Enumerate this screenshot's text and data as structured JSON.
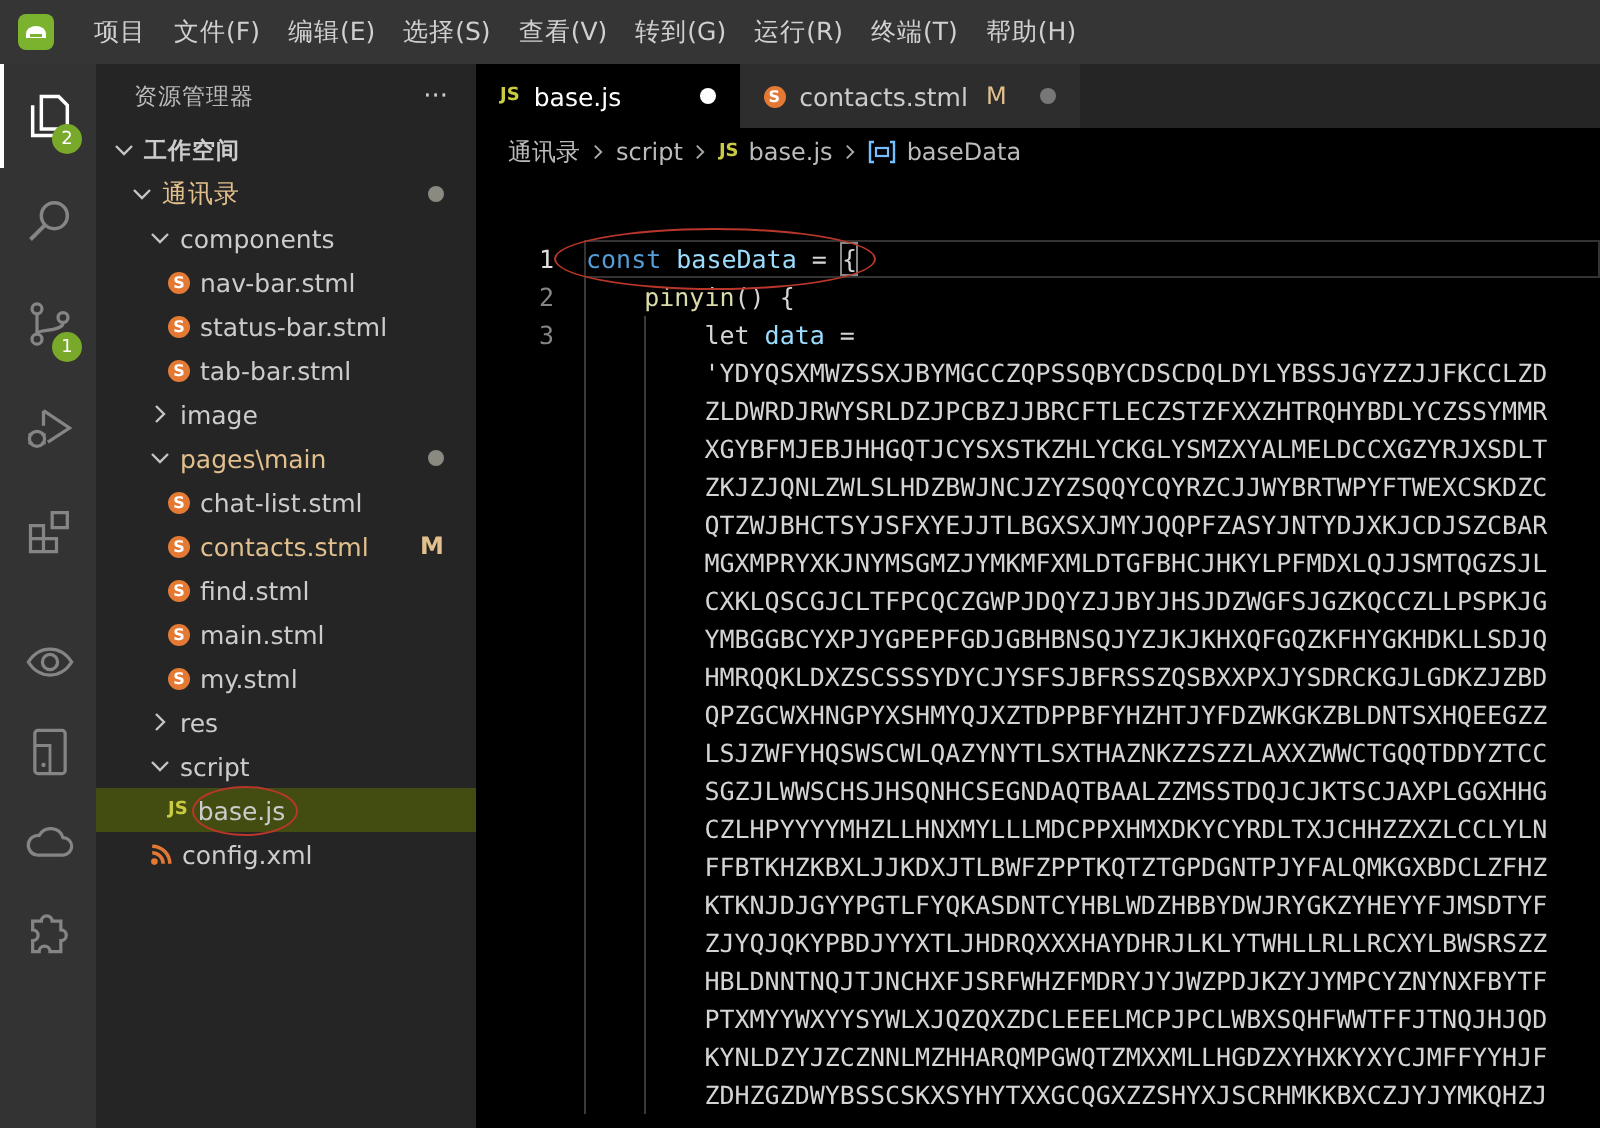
{
  "menu_bar": {
    "items": [
      "项目",
      "文件(F)",
      "编辑(E)",
      "选择(S)",
      "查看(V)",
      "转到(G)",
      "运行(R)",
      "终端(T)",
      "帮助(H)"
    ]
  },
  "activity_bar": [
    {
      "kind": "files",
      "selected": true,
      "badge": "2"
    },
    {
      "kind": "search",
      "selected": false
    },
    {
      "kind": "source-control",
      "selected": false,
      "badge": "1"
    },
    {
      "kind": "run-debug",
      "selected": false
    },
    {
      "kind": "extensions",
      "selected": false
    },
    {
      "kind": "preview",
      "selected": false
    },
    {
      "kind": "device",
      "selected": false
    },
    {
      "kind": "cloud",
      "selected": false
    },
    {
      "kind": "plugin",
      "selected": false
    }
  ],
  "sidebar": {
    "title": "资源管理器",
    "more": "···",
    "tree": [
      {
        "label": "工作空间",
        "kind": "root",
        "expanded": true,
        "selected": false,
        "modified": false,
        "children": [
          {
            "label": "通讯录",
            "kind": "folder",
            "expanded": true,
            "selected": false,
            "modified": true,
            "children": [
              {
                "label": "components",
                "kind": "folder",
                "expanded": true,
                "selected": false,
                "modified": false,
                "children": [
                  {
                    "label": "nav-bar.stml",
                    "kind": "stml",
                    "icon_text": "S",
                    "selected": false,
                    "modified": false
                  },
                  {
                    "label": "status-bar.stml",
                    "kind": "stml",
                    "icon_text": "S",
                    "selected": false,
                    "modified": false
                  },
                  {
                    "label": "tab-bar.stml",
                    "kind": "stml",
                    "icon_text": "S",
                    "selected": false,
                    "modified": false
                  }
                ]
              },
              {
                "label": "image",
                "kind": "folder",
                "expanded": false,
                "selected": false,
                "modified": false
              },
              {
                "label": "pages\\main",
                "kind": "folder",
                "expanded": true,
                "selected": false,
                "modified": true,
                "children": [
                  {
                    "label": "chat-list.stml",
                    "kind": "stml",
                    "icon_text": "S",
                    "selected": false,
                    "modified": false
                  },
                  {
                    "label": "contacts.stml",
                    "kind": "stml",
                    "icon_text": "S",
                    "selected": false,
                    "modified": true,
                    "badge": "M"
                  },
                  {
                    "label": "find.stml",
                    "kind": "stml",
                    "icon_text": "S",
                    "selected": false,
                    "modified": false
                  },
                  {
                    "label": "main.stml",
                    "kind": "stml",
                    "icon_text": "S",
                    "selected": false,
                    "modified": false
                  },
                  {
                    "label": "my.stml",
                    "kind": "stml",
                    "icon_text": "S",
                    "selected": false,
                    "modified": false
                  }
                ]
              },
              {
                "label": "res",
                "kind": "folder",
                "expanded": false,
                "selected": false,
                "modified": false
              },
              {
                "label": "script",
                "kind": "folder",
                "expanded": true,
                "selected": false,
                "modified": false,
                "children": [
                  {
                    "label": "base.js",
                    "kind": "js",
                    "icon_text": "JS",
                    "selected": true,
                    "modified": false,
                    "circled": true
                  }
                ]
              },
              {
                "label": "config.xml",
                "kind": "xml",
                "selected": false,
                "modified": false
              }
            ]
          }
        ]
      }
    ]
  },
  "tabs": [
    {
      "label": "base.js",
      "kind": "js",
      "icon_text": "JS",
      "selected": true,
      "unsaved": true
    },
    {
      "label": "contacts.stml",
      "kind": "stml",
      "icon_text": "S",
      "selected": false,
      "unsaved": true,
      "badge": "M"
    }
  ],
  "breadcrumb": [
    {
      "label": "通讯录",
      "kind": "folder"
    },
    {
      "label": "script",
      "kind": "folder"
    },
    {
      "label": "base.js",
      "kind": "js",
      "icon_text": "JS"
    },
    {
      "label": "baseData",
      "kind": "symbol"
    }
  ],
  "code": {
    "lines": [
      {
        "number": "1",
        "current": true,
        "circled": true,
        "tokens": [
          {
            "text": "const ",
            "kind": "keyword"
          },
          {
            "text": "baseData",
            "kind": "variable"
          },
          {
            "text": " = ",
            "kind": "operator"
          },
          {
            "text": "{",
            "kind": "bracket_match"
          }
        ],
        "children": [
          {
            "number": "2",
            "current": false,
            "tokens": [
              {
                "text": "pinyin",
                "kind": "function"
              },
              {
                "text": "() {",
                "kind": "punctuation"
              }
            ],
            "children": [
              {
                "number": "3",
                "current": false,
                "tokens": [
                  {
                    "text": "let ",
                    "kind": "plain"
                  },
                  {
                    "text": "data",
                    "kind": "variable"
                  },
                  {
                    "text": " =",
                    "kind": "operator"
                  }
                ],
                "wrap": [
                  "'YDYQSXMWZSSXJBYMGCCZQPSSQBYCDSCDQLDYLYBSSJGYZZJJFKCCLZD",
                  "ZLDWRDJRWYSRLDZJPCBZJJBRCFTLECZSTZFXXZHTRQHYBDLYCZSSYMMR",
                  "XGYBFMJEBJHHGQTJCYSXSTKZHLYCKGLYSMZXYALMELDCCXGZYRJXSDLT",
                  "ZKJZJQNLZWLSLHDZBWJNCJZYZSQQYCQYRZCJJWYBRTWPYFTWEXCSKDZC",
                  "QTZWJBHCTSYJSFXYEJJTLBGXSXJMYJQQPFZASYJNTYDJXKJCDJSZCBAR",
                  "MGXMPRYXKJNYMSGMZJYMKMFXMLDTGFBHCJHKYLPFMDXLQJJSMTQGZSJL",
                  "CXKLQSCGJCLTFPCQCZGWPJDQYZJJBYJHSJDZWGFSJGZKQCCZLLPSPKJG",
                  "YMBGGBCYXPJYGPEPFGDJGBHBNSQJYZJKJKHXQFGQZKFHYGKHDKLLSDJQ",
                  "HMRQQKLDXZSCSSSYDYCJYSFSJBFRSSZQSBXXPXJYSDRCKGJLGDKZJZBD",
                  "QPZGCWXHNGPYXSHMYQJXZTDPPBFYHZHTJYFDZWKGKZBLDNTSXHQEEGZZ",
                  "LSJZWFYHQSWSCWLQAZYNYTLSXTHAZNKZZSZZLAXXZWWCTGQQTDDYZTCC",
                  "SGZJLWWSCHSJHSQNHCSEGNDAQTBAALZZMSSTDQJCJKTSCJAXPLGGXHHG",
                  "CZLHPYYYYMHZLLHNXMYLLLMDCPPXHMXDKYCYRDLTXJCHHZZXZLCCLYLN",
                  "FFBTKHZKBXLJJKDXJTLBWFZPPTKQTZTGPDGNTPJYFALQMKGXBDCLZFHZ",
                  "KTKNJDJGYYPGTLFYQKASDNTCYHBLWDZHBBYDWJRYGKZYHEYYFJMSDTYF",
                  "ZJYQJQKYPBDJYYXTLJHDRQXXXHAYDHRJLKLYTWHLLRLLRCXYLBWSRSZZ",
                  "HBLDNNTNQJTJNCHXFJSRFWHZFMDRYJYJWZPDJKZYJYMPCYZNYNXFBYTF",
                  "PTXMYYWXYYSYWLXJQZQXZDCLEEELMCPJPCLWBXSQHFWWTFFJTNQJHJQD",
                  "KYNLDZYJZCZNNLMZHHARQMPGWQTZMXXMLLHGDZXYHXKYXYCJMFFYYHJF",
                  "ZDHZGZDWYBSSCSKXSYHYTXXGCQGXZZSHYXJSCRHMKKBXCZJYJYMKQHZJ"
                ]
              }
            ]
          }
        ]
      }
    ]
  }
}
